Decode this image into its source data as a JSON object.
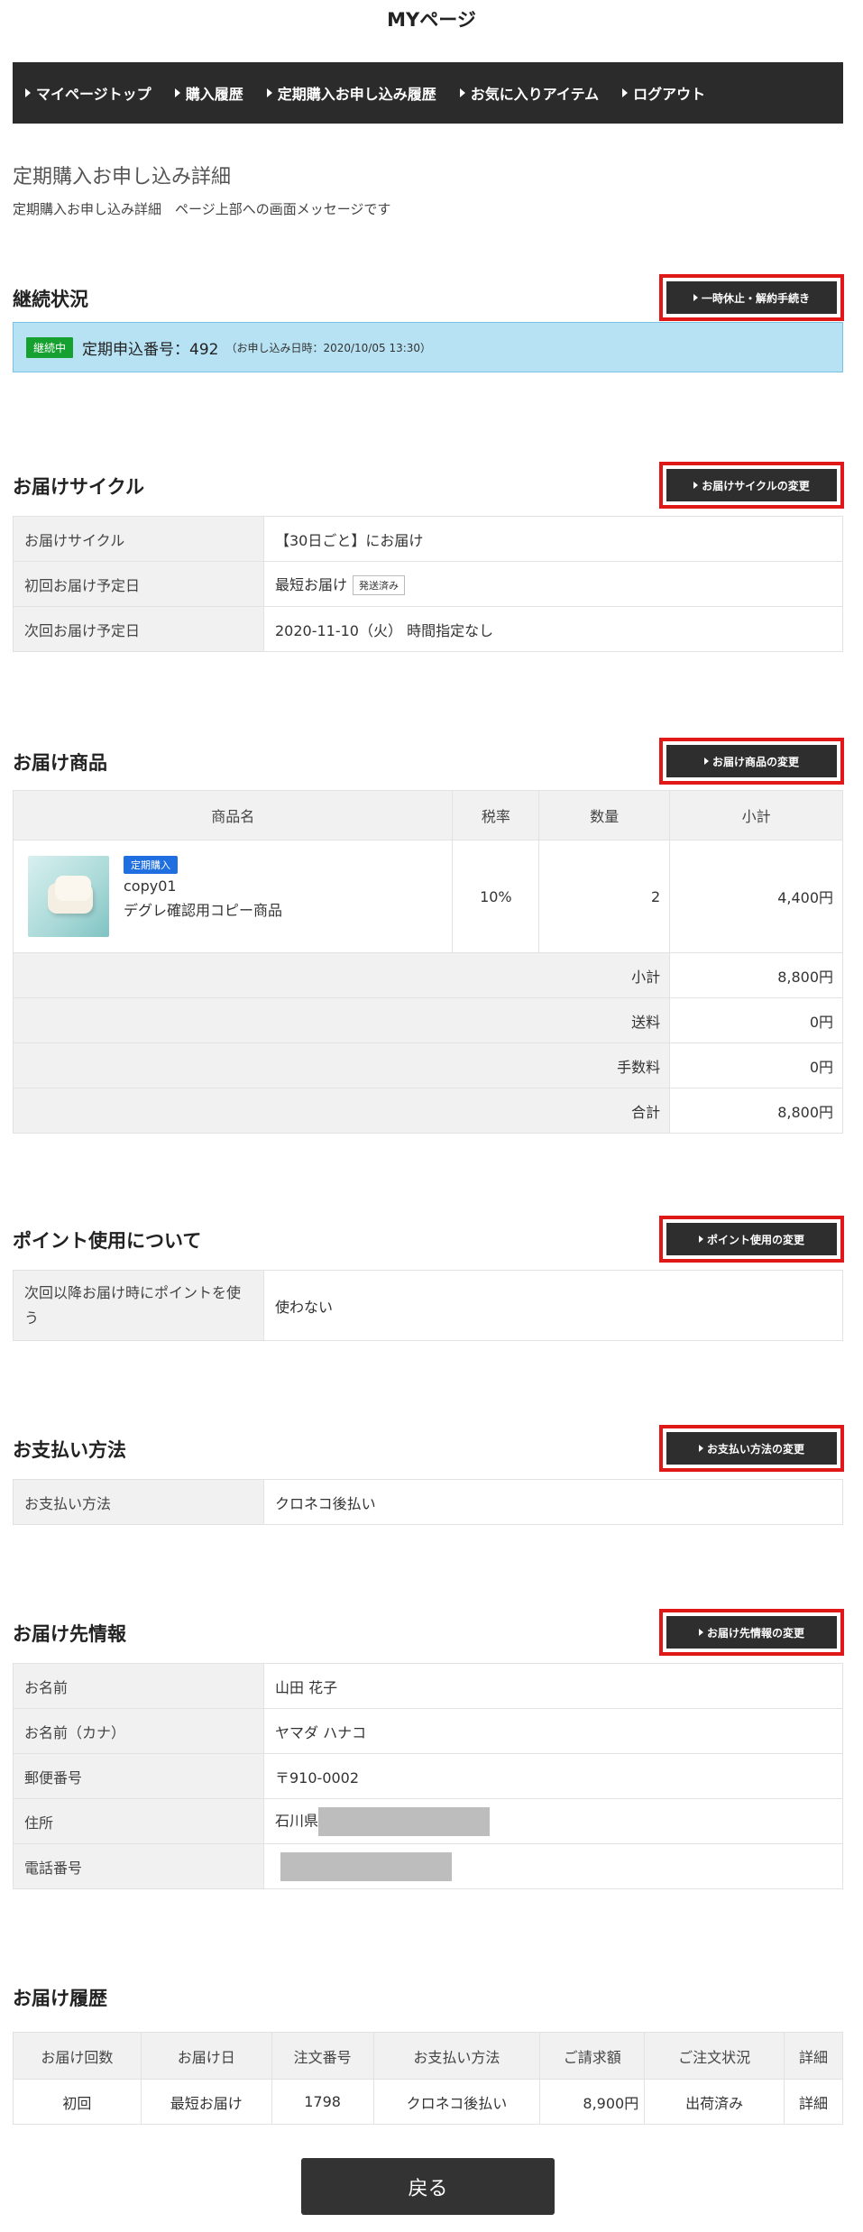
{
  "page_title": "MYページ",
  "nav": [
    {
      "label": "マイページトップ"
    },
    {
      "label": "購入履歴"
    },
    {
      "label": "定期購入お申し込み履歴"
    },
    {
      "label": "お気に入りアイテム"
    },
    {
      "label": "ログアウト"
    }
  ],
  "detail": {
    "heading": "定期購入お申し込み詳細",
    "message": "定期購入お申し込み詳細　ページ上部への画面メッセージです"
  },
  "status_section": {
    "title": "継続状況",
    "button": "一時休止・解約手続き",
    "badge": "継続中",
    "order_number": "定期申込番号：492",
    "order_date": "（お申し込み日時：2020/10/05 13:30）"
  },
  "cycle_section": {
    "title": "お届けサイクル",
    "button": "お届けサイクルの変更",
    "rows": [
      {
        "key": "お届けサイクル",
        "value": "【30日ごと】にお届け"
      },
      {
        "key": "初回お届け予定日",
        "value": "最短お届け",
        "tag": "発送済み"
      },
      {
        "key": "次回お届け予定日",
        "value": "2020-11-10（火） 時間指定なし"
      }
    ]
  },
  "product_section": {
    "title": "お届け商品",
    "button": "お届け商品の変更",
    "headers": {
      "name": "商品名",
      "tax": "税率",
      "qty": "数量",
      "subtotal": "小計"
    },
    "item": {
      "tag": "定期購入",
      "code": "copy01",
      "name": "デグレ確認用コピー商品",
      "tax": "10%",
      "qty": "2",
      "subtotal": "4,400円"
    },
    "summary": [
      {
        "label": "小計",
        "value": "8,800円"
      },
      {
        "label": "送料",
        "value": "0円"
      },
      {
        "label": "手数料",
        "value": "0円"
      },
      {
        "label": "合計",
        "value": "8,800円"
      }
    ]
  },
  "point_section": {
    "title": "ポイント使用について",
    "button": "ポイント使用の変更",
    "key": "次回以降お届け時にポイントを使う",
    "value": "使わない"
  },
  "payment_section": {
    "title": "お支払い方法",
    "button": "お支払い方法の変更",
    "key": "お支払い方法",
    "value": "クロネコ後払い"
  },
  "address_section": {
    "title": "お届け先情報",
    "button": "お届け先情報の変更",
    "rows": [
      {
        "key": "お名前",
        "value": "山田 花子"
      },
      {
        "key": "お名前（カナ）",
        "value": "ヤマダ ハナコ"
      },
      {
        "key": "郵便番号",
        "value": "〒910-0002"
      },
      {
        "key": "住所",
        "value": "石川県"
      },
      {
        "key": "電話番号",
        "value": ""
      }
    ]
  },
  "history_section": {
    "title": "お届け履歴",
    "headers": [
      "お届け回数",
      "お届け日",
      "注文番号",
      "お支払い方法",
      "ご請求額",
      "ご注文状況",
      "詳細"
    ],
    "row": [
      "初回",
      "最短お届け",
      "1798",
      "クロネコ後払い",
      "8,900円",
      "出荷済み",
      "詳細"
    ]
  },
  "back_button": "戻る"
}
